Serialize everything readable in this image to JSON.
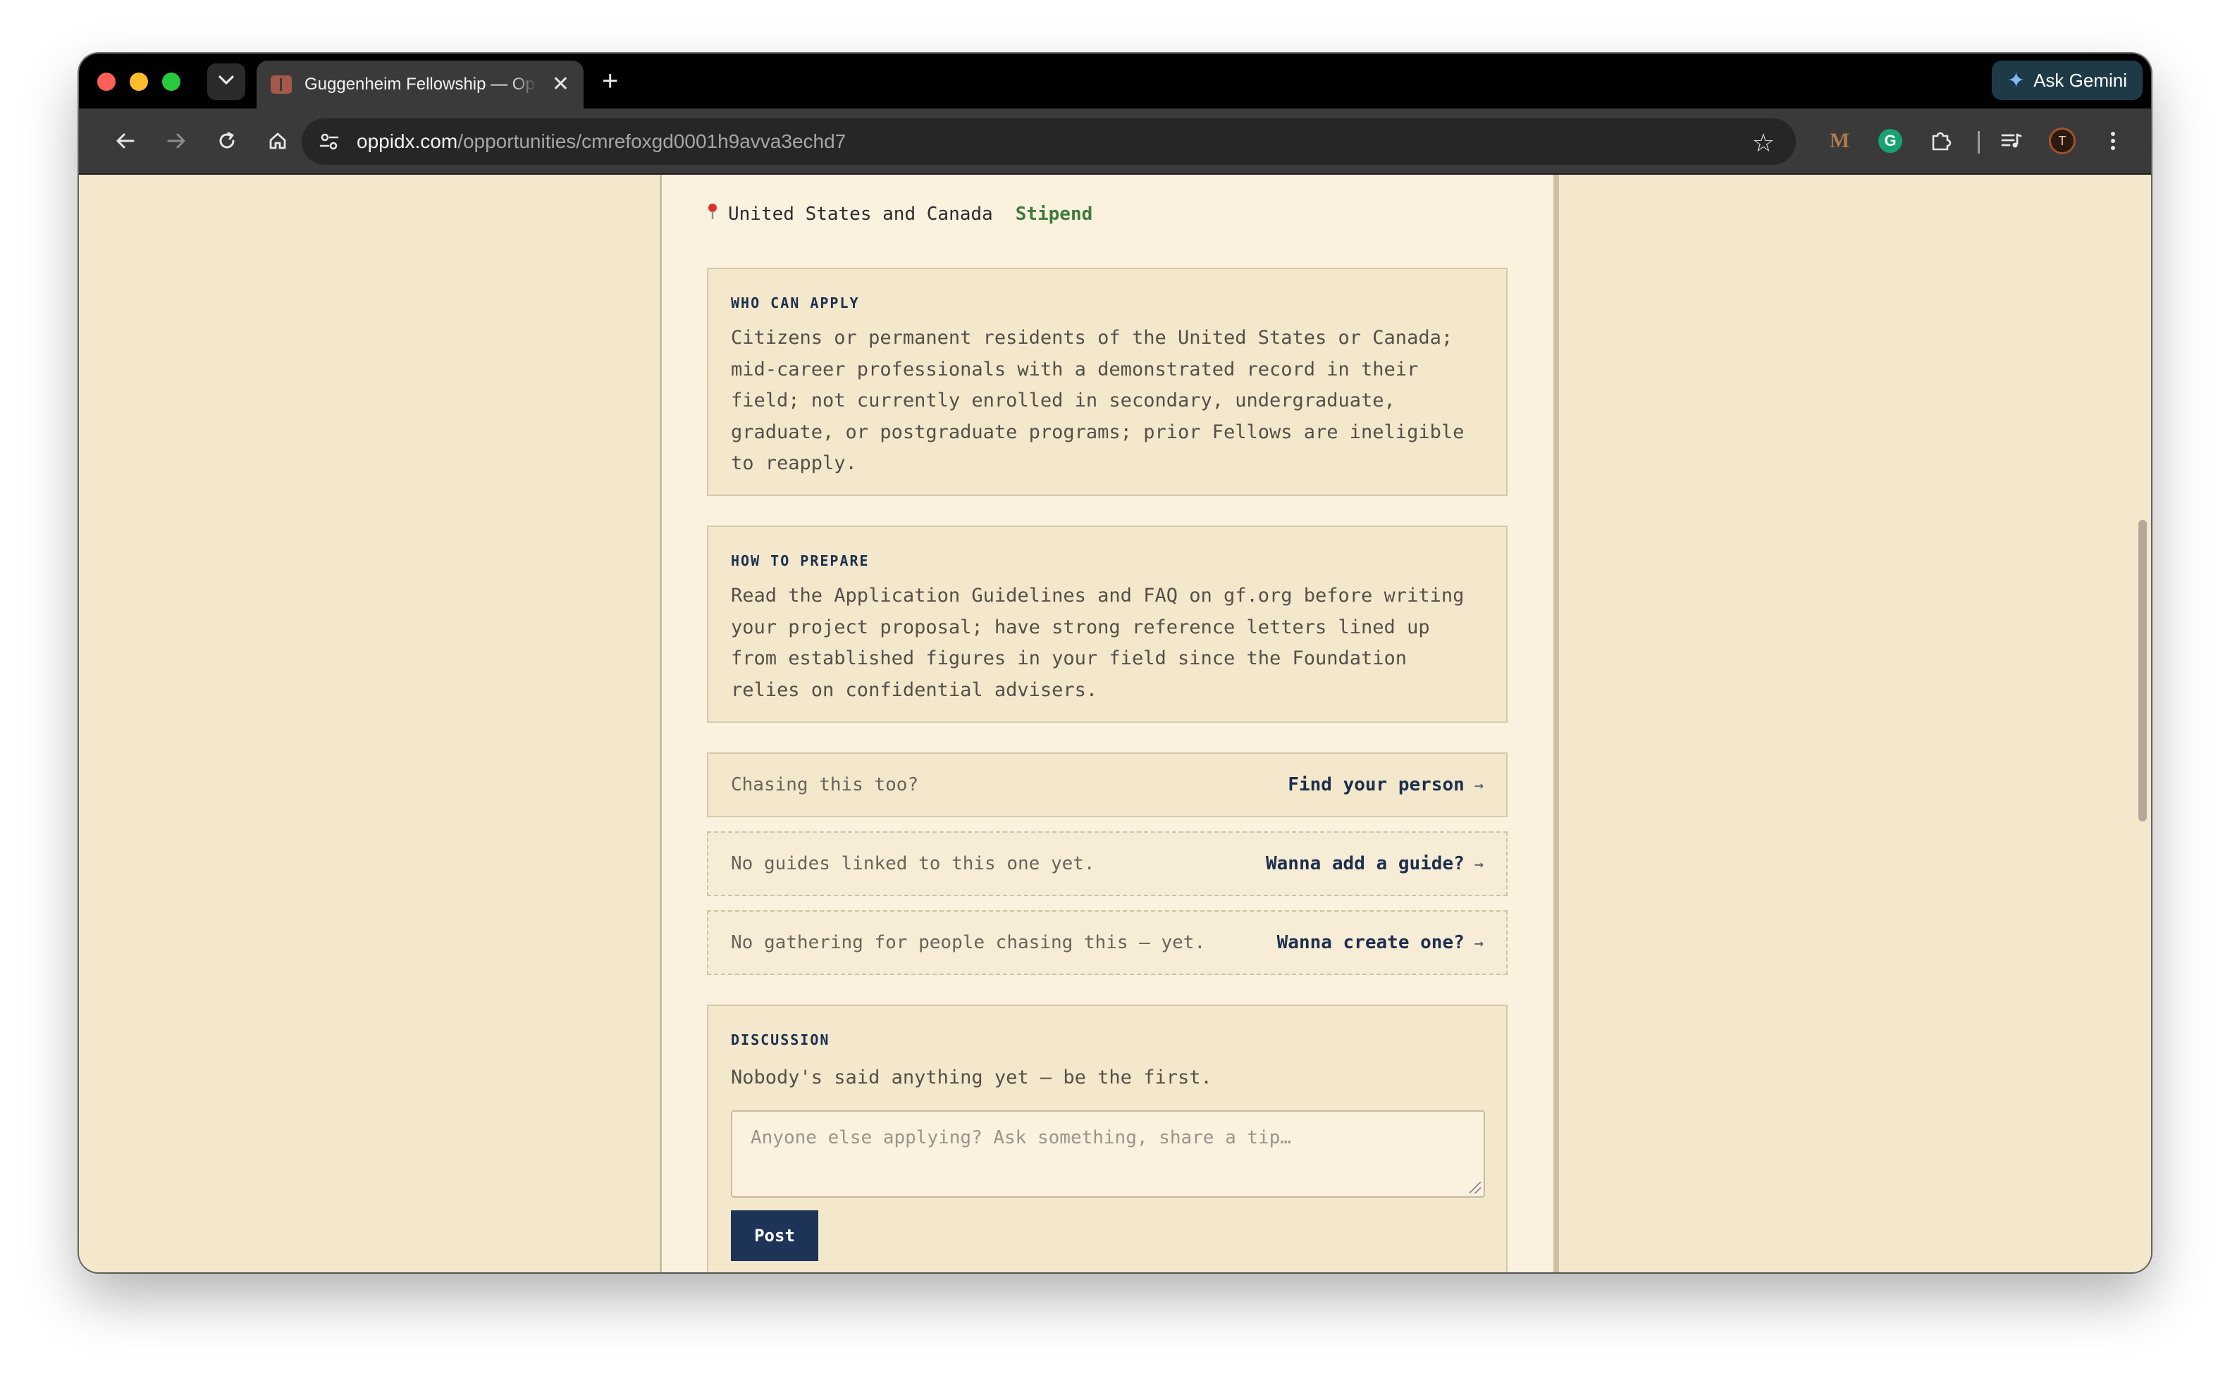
{
  "browser": {
    "tab_title": "Guggenheim Fellowship — Oppidx",
    "close_glyph": "✕",
    "new_tab_glyph": "+",
    "gemini_label": "Ask Gemini",
    "url_host": "oppidx.com",
    "url_path": "/opportunities/cmrefoxgd0001h9avva3echd7",
    "avatar_letter": "T",
    "ext_m_glyph": "M",
    "ext_g_glyph": "G"
  },
  "opportunity": {
    "location": "United States and Canada",
    "funding_type": "Stipend",
    "who_can_apply": {
      "heading": "WHO CAN APPLY",
      "body": "Citizens or permanent residents of the United States or Canada; mid-career professionals with a demonstrated record in their field; not currently enrolled in secondary, undergraduate, graduate, or postgraduate programs; prior Fellows are ineligible to reapply."
    },
    "how_to_prepare": {
      "heading": "HOW TO PREPARE",
      "body": "Read the Application Guidelines and FAQ on gf.org before writing your project proposal; have strong reference letters lined up from established figures in your field since the Foundation relies on confidential advisers."
    }
  },
  "rows": {
    "person": {
      "text": "Chasing this too?",
      "link": "Find your person"
    },
    "guides": {
      "text": "No guides linked to this one yet.",
      "link": "Wanna add a guide?"
    },
    "gathering": {
      "text": "No gathering for people chasing this — yet.",
      "link": "Wanna create one?"
    },
    "arrow": "→"
  },
  "discussion": {
    "heading": "DISCUSSION",
    "empty_text": "Nobody's said anything yet — be the first.",
    "placeholder": "Anyone else applying? Ask something, share a tip…",
    "post_label": "Post"
  },
  "colors": {
    "page_bg": "#f3e8cc",
    "column_bg": "#faf1df",
    "accent_navy": "#1d3458",
    "stipend_green": "#3f7a3c",
    "pin_red": "#d9342b"
  }
}
